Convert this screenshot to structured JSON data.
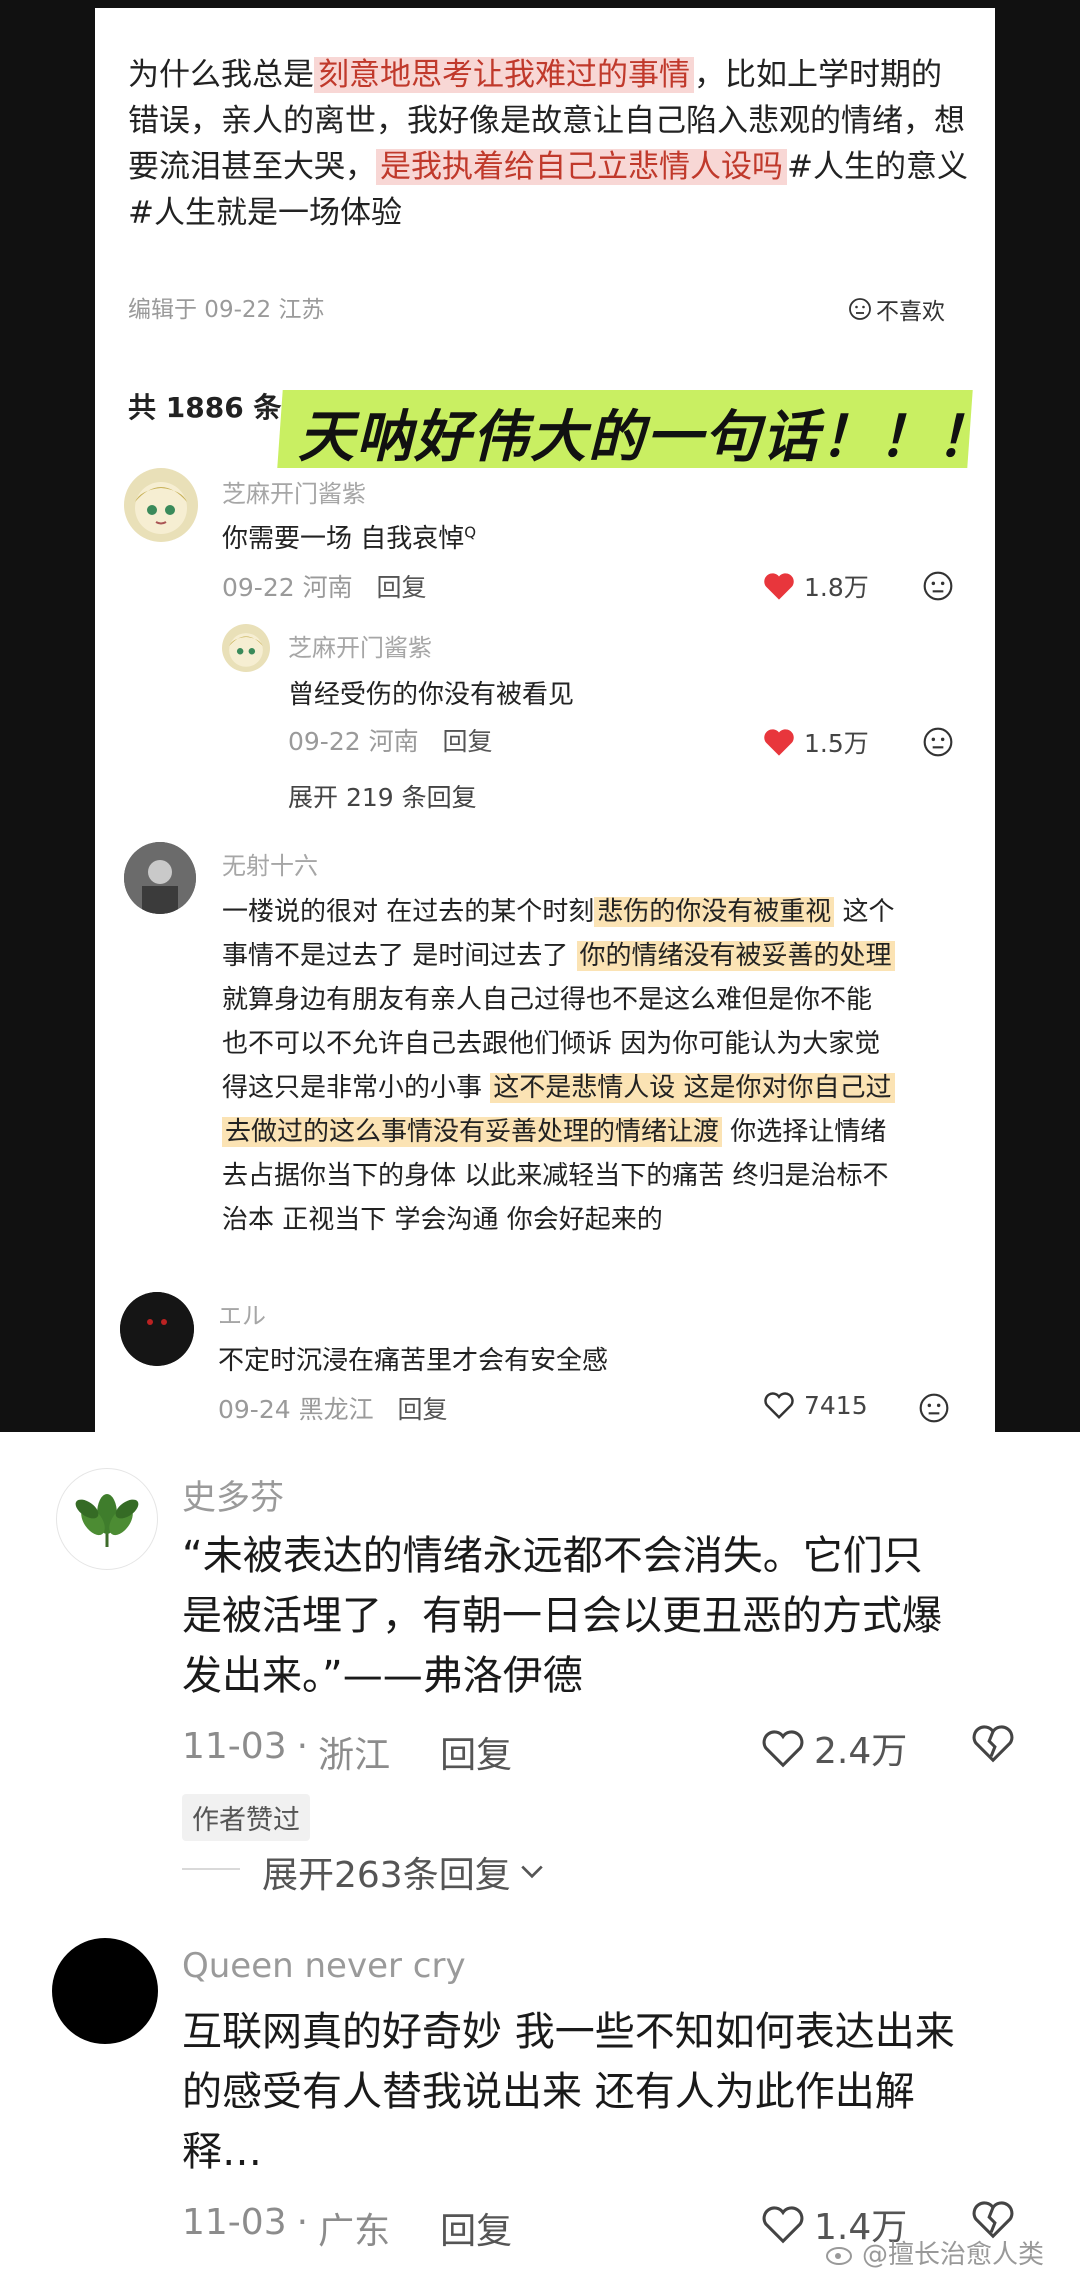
{
  "post": {
    "text_part1": "为什么我总是",
    "text_hl1": "刻意地思考让我难过的事情",
    "text_part2": "，比如上学时期的错误，亲人的离世，我好像是故意让自己陷入悲观的情绪，想要流泪甚至大哭，",
    "text_hl2": "是我执着给自己立悲情人设吗",
    "text_part3": "#人生的意义#人生就是一场体验",
    "meta": "编辑于 09-22 江苏",
    "dislike_label": "不喜欢"
  },
  "comment_count": "共 1886 条评",
  "banner": "天呐好伟大的一句话！！！",
  "comments_top": [
    {
      "name": "芝麻开门酱紫",
      "text": "你需要一场 自我哀悼",
      "text_suffix": "Q",
      "meta": "09-22 河南",
      "reply": "回复",
      "likes": "1.8万"
    },
    {
      "name": "芝麻开门酱紫",
      "text": "曾经受伤的你没有被看见",
      "meta": "09-22 河南",
      "reply": "回复",
      "likes": "1.5万"
    }
  ],
  "expand_replies_1": "展开 219 条回复",
  "comment_long": {
    "name": "无射十六",
    "line1_a": "一楼说的很对 在过去的某个时刻",
    "line1_hl": "悲伤的你没有被重视",
    "line1_b": " 这个",
    "line2_a": "事情不是过去了 是时间过去了 ",
    "line2_hl": "你的情绪没有被妥善的处理",
    "line3": "就算身边有朋友有亲人自己过得也不是这么难但是你不能",
    "line4": "也不可以不允许自己去跟他们倾诉 因为你可能认为大家觉",
    "line5_a": "得这只是非常小的小事 ",
    "line5_hl": "这不是悲情人设 这是你对你自己过",
    "line6_hl": "去做过的这么事情没有妥善处理的情绪让渡",
    "line6_b": " 你选择让情绪",
    "line7": "去占据你当下的身体 以此来减轻当下的痛苦 终归是治标不",
    "line8": "治本 正视当下 学会沟通 你会好起来的"
  },
  "comment_el": {
    "name": "エル",
    "text": "不定时沉浸在痛苦里才会有安全感",
    "meta": "09-24 黑龙江",
    "reply": "回复",
    "likes": "7415"
  },
  "bottom_comments": [
    {
      "name": "史多芬",
      "line1": "“未被表达的情绪永远都不会消失。它们只",
      "line2": "是被活埋了，有朝一日会以更丑恶的方式爆",
      "line3": "发出来。”——弗洛伊德",
      "date": "11-03",
      "location": "浙江",
      "reply": "回复",
      "likes": "2.4万",
      "tag": "作者赞过",
      "expand": "展开263条回复"
    },
    {
      "name": "Queen never cry",
      "line1": "互联网真的好奇妙 我一些不知如何表达出来",
      "line2": "的感受有人替我说出来 还有人为此作出解",
      "line3": "释…",
      "date": "11-03",
      "location": "广东",
      "reply": "回复",
      "likes": "1.4万"
    }
  ],
  "watermark": "@擅长治愈人类",
  "colors": {
    "highlight_red": "#f8d7d5",
    "highlight_yellow": "#fbe3b4",
    "banner_green": "#c9ef62",
    "heart_red": "#e8363c"
  }
}
